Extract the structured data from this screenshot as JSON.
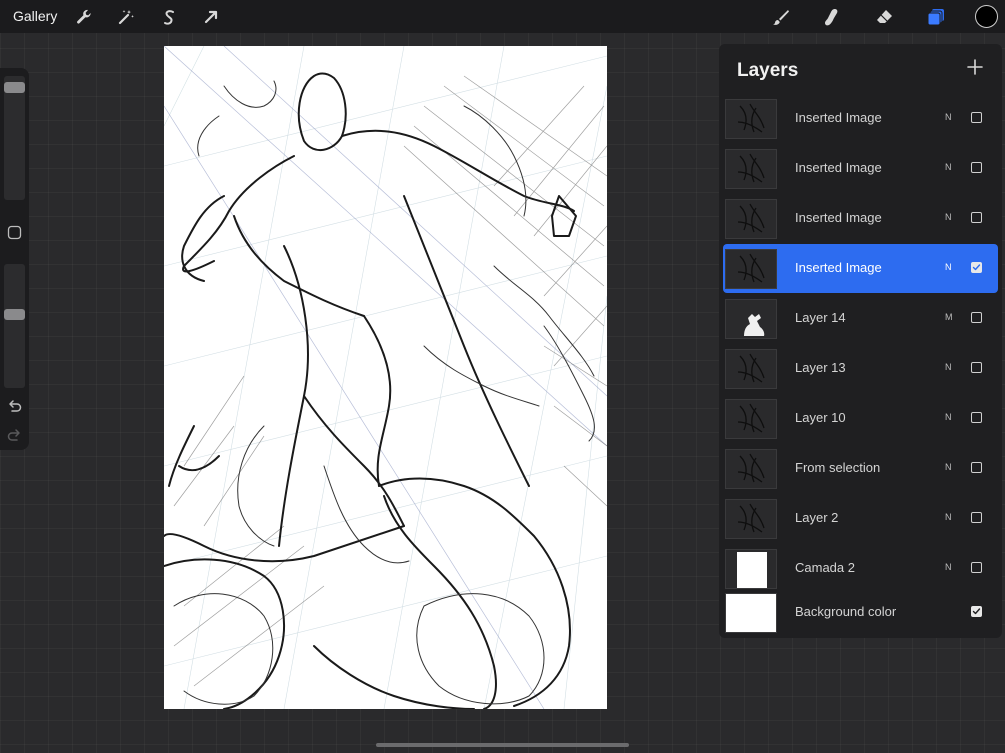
{
  "app": {
    "gallery_label": "Gallery"
  },
  "toolbar": {
    "left_tools": [
      "wrench-icon",
      "magic-wand-icon",
      "selection-s-icon",
      "transform-arrow-icon"
    ],
    "right_tools": [
      "brush-icon",
      "smudge-icon",
      "eraser-icon",
      "layers-icon"
    ],
    "active_tool": "layers",
    "current_color": "#000000",
    "accent_color": "#2d6cf0"
  },
  "sidebar": {
    "brush_size": 0.95,
    "opacity": 0.6,
    "icons": [
      "modify-square-icon",
      "undo-icon",
      "redo-icon"
    ]
  },
  "layers": {
    "title": "Layers",
    "add_icon": "plus-icon",
    "items": [
      {
        "name": "Inserted Image",
        "mode": "N",
        "visible": false,
        "selected": false,
        "thumb": "dark"
      },
      {
        "name": "Inserted Image",
        "mode": "N",
        "visible": false,
        "selected": false,
        "thumb": "dark"
      },
      {
        "name": "Inserted Image",
        "mode": "N",
        "visible": false,
        "selected": false,
        "thumb": "dark"
      },
      {
        "name": "Inserted Image",
        "mode": "N",
        "visible": true,
        "selected": true,
        "thumb": "dark"
      },
      {
        "name": "Layer 14",
        "mode": "M",
        "visible": false,
        "selected": false,
        "thumb": "silhouette"
      },
      {
        "name": "Layer 13",
        "mode": "N",
        "visible": false,
        "selected": false,
        "thumb": "dark"
      },
      {
        "name": "Layer 10",
        "mode": "N",
        "visible": false,
        "selected": false,
        "thumb": "dark"
      },
      {
        "name": "From selection",
        "mode": "N",
        "visible": false,
        "selected": false,
        "thumb": "dark"
      },
      {
        "name": "Layer 2",
        "mode": "N",
        "visible": false,
        "selected": false,
        "thumb": "dark"
      },
      {
        "name": "Camada 2",
        "mode": "N",
        "visible": false,
        "selected": false,
        "thumb": "white-page"
      },
      {
        "name": "Background color",
        "mode": "",
        "visible": true,
        "selected": false,
        "thumb": "white"
      }
    ]
  }
}
